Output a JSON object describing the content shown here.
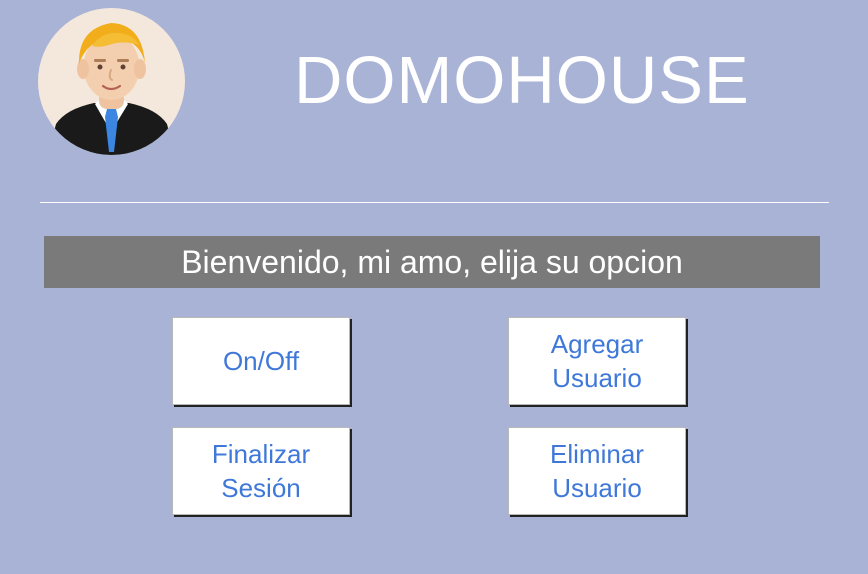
{
  "app": {
    "title": "DOMOHOUSE",
    "banner": "Bienvenido, mi amo, elija su opcion"
  },
  "buttons": {
    "on_off": "On/Off",
    "add_user": "Agregar\nUsuario",
    "logout": "Finalizar\nSesión",
    "delete_user": "Eliminar\nUsuario"
  },
  "icons": {
    "avatar": "user-avatar-icon"
  },
  "colors": {
    "background": "#a9b3d6",
    "banner": "#7a7a7a",
    "button_text": "#3f78d9",
    "title": "#ffffff"
  }
}
